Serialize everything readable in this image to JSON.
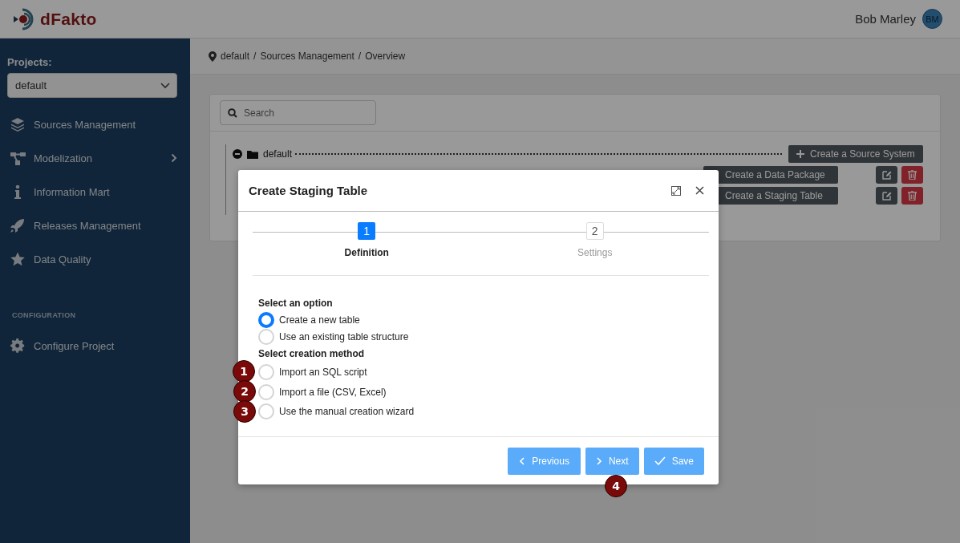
{
  "header": {
    "logo_text": "dFakto",
    "user_name": "Bob Marley",
    "avatar_initials": "BM"
  },
  "sidebar": {
    "projects_label": "Projects:",
    "project_select": {
      "value": "default"
    },
    "items": [
      {
        "label": "Sources Management",
        "expandable": false
      },
      {
        "label": "Modelization",
        "expandable": true
      },
      {
        "label": "Information Mart",
        "expandable": false
      },
      {
        "label": "Releases Management",
        "expandable": false
      },
      {
        "label": "Data Quality",
        "expandable": false
      }
    ],
    "section_title": "CONFIGURATION",
    "config_items": [
      {
        "label": "Configure Project",
        "expandable": false
      }
    ]
  },
  "breadcrumb": {
    "items": [
      "default",
      "Sources Management",
      "Overview"
    ],
    "separators": [
      "/",
      "/"
    ]
  },
  "search": {
    "placeholder": "Search"
  },
  "tree": {
    "root": {
      "label": "default",
      "expanded": true
    }
  },
  "actions": [
    {
      "label": "Create a Source System",
      "row_tools": false
    },
    {
      "label": "Create a Data Package",
      "row_tools": true
    },
    {
      "label": "Create a Staging Table",
      "row_tools": true
    }
  ],
  "modal": {
    "title": "Create Staging Table",
    "steps": [
      {
        "number": "1",
        "label": "Definition",
        "selected": true
      },
      {
        "number": "2",
        "label": "Settings",
        "selected": false
      }
    ],
    "groups": [
      {
        "title": "Select an option",
        "options": [
          {
            "label": "Create a new table",
            "selected": true
          },
          {
            "label": "Use an existing table structure",
            "selected": false
          }
        ]
      },
      {
        "title": "Select creation method",
        "options": [
          {
            "label": "Import an SQL script",
            "selected": false
          },
          {
            "label": "Import a file (CSV, Excel)",
            "selected": false
          },
          {
            "label": "Use the manual creation wizard",
            "selected": false
          }
        ]
      }
    ],
    "buttons": [
      {
        "label": "Previous",
        "kind": "previous"
      },
      {
        "label": "Next",
        "kind": "next"
      },
      {
        "label": "Save",
        "kind": "save"
      }
    ]
  },
  "callouts": [
    "1",
    "2",
    "3",
    "4"
  ]
}
